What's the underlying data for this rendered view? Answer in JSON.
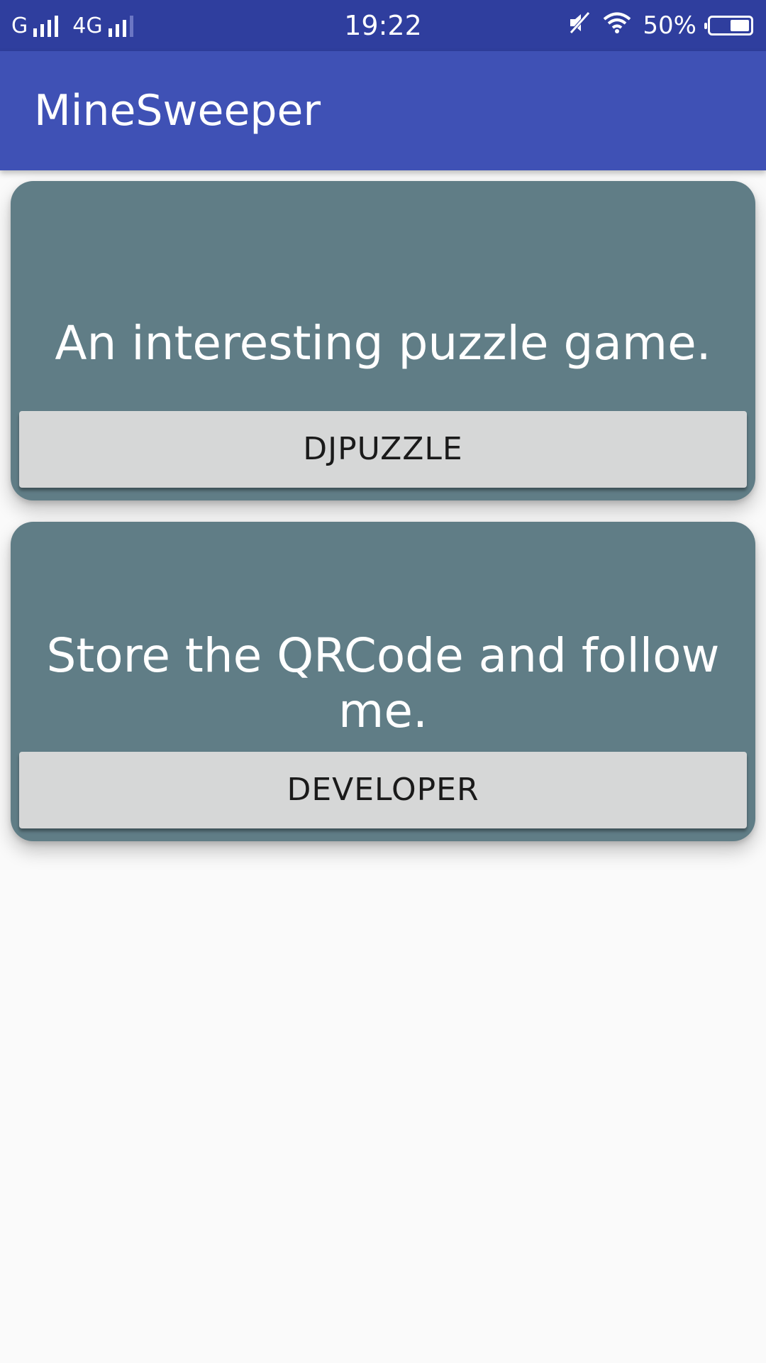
{
  "status_bar": {
    "carrier_1": "G",
    "carrier_2": "4G",
    "time": "19:22",
    "battery_percent": "50%",
    "battery_level": 0.5,
    "icons": [
      "signal-icon",
      "signal-icon",
      "mute-icon",
      "wifi-icon",
      "battery-icon"
    ]
  },
  "app_bar": {
    "title": "MineSweeper",
    "color": "#3f51b5"
  },
  "cards": [
    {
      "text": "An interesting puzzle game.",
      "button_label": "DJPUZZLE"
    },
    {
      "text": "Store the QRCode and follow me.",
      "button_label": "DEVELOPER"
    }
  ],
  "colors": {
    "status_bar": "#2f3e9e",
    "card": "#607d86",
    "button": "#d6d7d7",
    "background": "#fafafa"
  }
}
